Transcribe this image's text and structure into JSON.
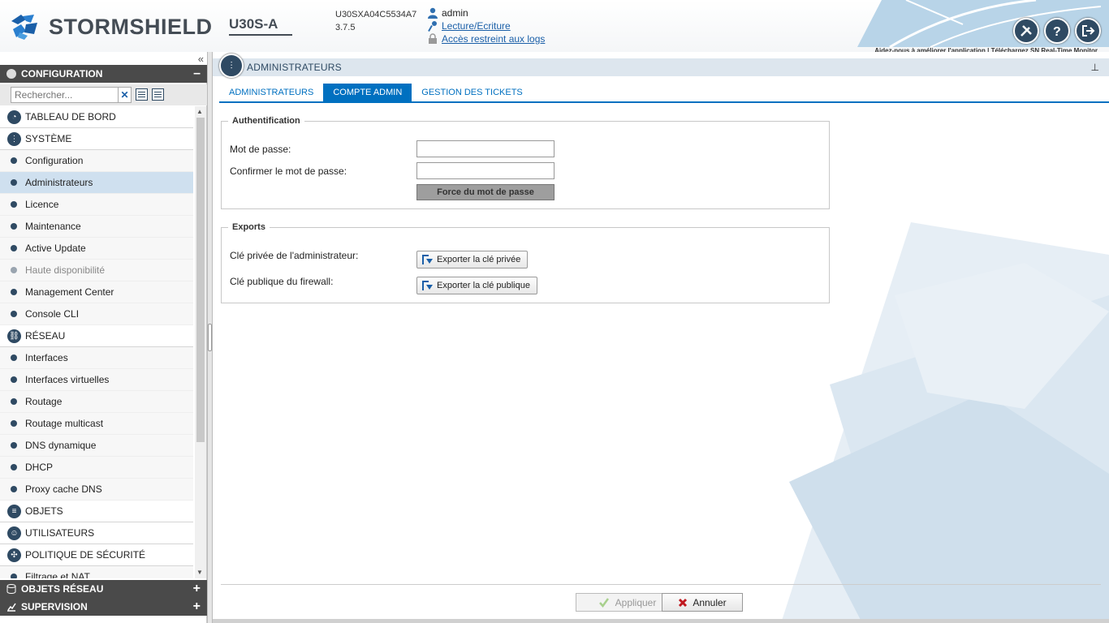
{
  "header": {
    "brand": "STORMSHIELD",
    "model": "U30S-A",
    "serial": "U30SXA04C5534A7",
    "version": "3.7.5",
    "user": "admin",
    "rights_link": "Lecture/Ecriture",
    "logs_link": "Accès restreint aux logs",
    "help_link": "Aidez-nous à améliorer l'application",
    "separator": "|",
    "monitor_link": "Téléchargez SN Real-Time Monitor",
    "icons": [
      "tools-icon",
      "help-icon",
      "logout-icon"
    ]
  },
  "sidebar": {
    "config_section": "CONFIGURATION",
    "config_toggle": "–",
    "search_placeholder": "Rechercher...",
    "search_clear": "✕",
    "items": [
      {
        "label": "TABLEAU DE BORD",
        "type": "top",
        "icon": "dashboard-icon"
      },
      {
        "label": "SYSTÈME",
        "type": "top",
        "icon": "system-icon"
      },
      {
        "label": "Configuration",
        "type": "sub"
      },
      {
        "label": "Administrateurs",
        "type": "sub",
        "selected": true
      },
      {
        "label": "Licence",
        "type": "sub"
      },
      {
        "label": "Maintenance",
        "type": "sub"
      },
      {
        "label": "Active Update",
        "type": "sub"
      },
      {
        "label": "Haute disponibilité",
        "type": "sub",
        "disabled": true
      },
      {
        "label": "Management Center",
        "type": "sub"
      },
      {
        "label": "Console CLI",
        "type": "sub"
      },
      {
        "label": "RÉSEAU",
        "type": "top",
        "icon": "network-icon"
      },
      {
        "label": "Interfaces",
        "type": "sub"
      },
      {
        "label": "Interfaces virtuelles",
        "type": "sub"
      },
      {
        "label": "Routage",
        "type": "sub"
      },
      {
        "label": "Routage multicast",
        "type": "sub"
      },
      {
        "label": "DNS dynamique",
        "type": "sub"
      },
      {
        "label": "DHCP",
        "type": "sub"
      },
      {
        "label": "Proxy cache DNS",
        "type": "sub"
      },
      {
        "label": "OBJETS",
        "type": "top",
        "icon": "objects-icon"
      },
      {
        "label": "UTILISATEURS",
        "type": "top",
        "icon": "users-icon"
      },
      {
        "label": "POLITIQUE DE SÉCURITÉ",
        "type": "top",
        "icon": "security-policy-icon"
      },
      {
        "label": "Filtrage et NAT",
        "type": "sub"
      }
    ],
    "objects_section": "OBJETS RÉSEAU",
    "supervision_section": "SUPERVISION",
    "expand_toggle": "+"
  },
  "main": {
    "title": "ADMINISTRATEURS",
    "tabs": [
      {
        "label": "ADMINISTRATEURS",
        "active": false
      },
      {
        "label": "COMPTE ADMIN",
        "active": true
      },
      {
        "label": "GESTION DES TICKETS",
        "active": false
      }
    ],
    "auth": {
      "legend": "Authentification",
      "password_label": "Mot de passe:",
      "password_value": "",
      "confirm_label": "Confirmer le mot de passe:",
      "confirm_value": "",
      "strength_label": "Force du mot de passe"
    },
    "exports": {
      "legend": "Exports",
      "private_label": "Clé privée de l'administrateur:",
      "private_button": "Exporter la clé privée",
      "public_label": "Clé publique du firewall:",
      "public_button": "Exporter la clé publique"
    },
    "apply_label": "Appliquer",
    "cancel_label": "Annuler"
  },
  "colors": {
    "accent": "#0070c0",
    "dark": "#2f4a63",
    "section": "#4a4a4a",
    "selected": "#cfe0ef"
  }
}
